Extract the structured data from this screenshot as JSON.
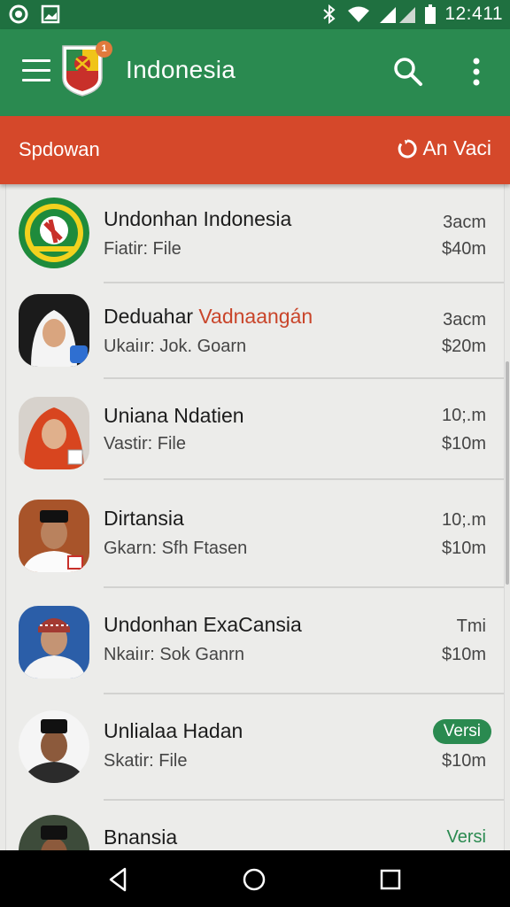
{
  "status_bar": {
    "time": "12:411",
    "icons": [
      "record-icon",
      "image-icon",
      "bluetooth-icon",
      "wifi-icon",
      "signal-icon",
      "battery-icon"
    ]
  },
  "app_bar": {
    "title": "Indonesia",
    "badge_count": "1",
    "bg_color": "#2a8a50"
  },
  "sub_bar": {
    "title": "Spdowan",
    "action_label": "An Vaci",
    "bg_color": "#d5482a"
  },
  "list": {
    "items": [
      {
        "name": "Undonhan Indonesia",
        "name_highlight": "",
        "sub": "Fiatir: File",
        "meta1": "3acm",
        "meta2": "$40m"
      },
      {
        "name": "Deduahar ",
        "name_highlight": "Vadnaangán",
        "sub": "Ukaiır: Jok. Goarn",
        "meta1": "3acm",
        "meta2": "$20m"
      },
      {
        "name": "Uniana Ndatien",
        "name_highlight": "",
        "sub": "Vastir: File",
        "meta1": "10;.m",
        "meta2": "$10m"
      },
      {
        "name": "Dirtansia",
        "name_highlight": "",
        "sub": "Gkarn: Sfh Ftasen",
        "meta1": "10;.m",
        "meta2": "$10m"
      },
      {
        "name": "Undonhan ExaCansia",
        "name_highlight": "",
        "sub": "Nkaiır: Sok Ganrn",
        "meta1": "Tmi",
        "meta2": "$10m"
      },
      {
        "name": "Unlialaa Hadan",
        "name_highlight": "",
        "sub": "Skatir: File",
        "meta1": "Versi",
        "meta2": "$10m"
      },
      {
        "name": "Bnansia",
        "name_highlight": "",
        "sub": "",
        "meta1": "Versi",
        "meta2": ""
      }
    ]
  },
  "nav_bar": {
    "buttons": [
      "back-icon",
      "home-icon",
      "recents-icon"
    ]
  }
}
